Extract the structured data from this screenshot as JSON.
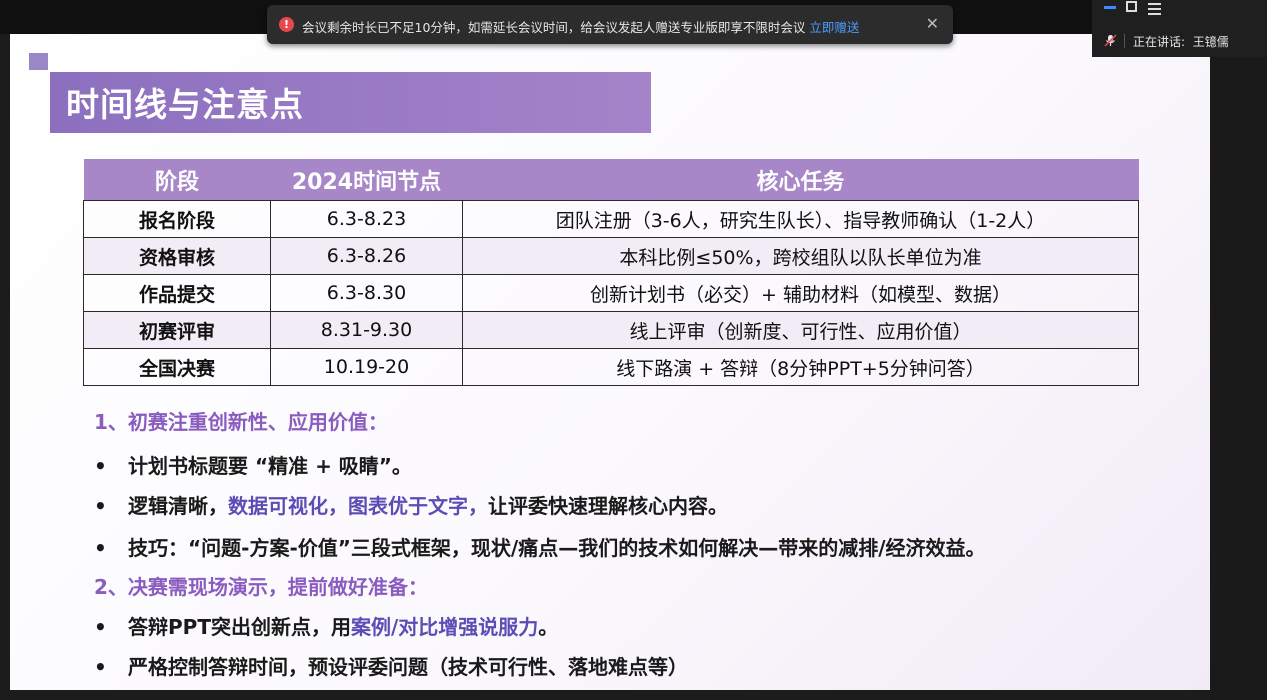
{
  "meeting": {
    "toast_message": "会议剩余时长已不足10分钟，如需延长会议时间，给会议发起人赠送专业版即享不限时会议",
    "toast_link": "立即赠送",
    "speaking_label": "正在讲话:",
    "speaker_name": "王镱儒"
  },
  "slide": {
    "title": "时间线与注意点",
    "table": {
      "headers": [
        "阶段",
        "2024时间节点",
        "核心任务"
      ],
      "rows": [
        [
          "报名阶段",
          "6.3-8.23",
          "团队注册（3-6人，研究生队长）、指导教师确认（1-2人）"
        ],
        [
          "资格审核",
          "6.3-8.26",
          "本科比例≤50%，跨校组队以队长单位为准"
        ],
        [
          "作品提交",
          "6.3-8.30",
          "创新计划书（必交）+ 辅助材料（如模型、数据）"
        ],
        [
          "初赛评审",
          "8.31-9.30",
          "线上评审（创新度、可行性、应用价值）"
        ],
        [
          "全国决赛",
          "10.19-20",
          "线下路演 + 答辩（8分钟PPT+5分钟问答）"
        ]
      ]
    },
    "notes": {
      "heading1": "1、初赛注重创新性、应用价值：",
      "bullet": "•",
      "b1": "计划书标题要 “精准 + 吸睛”。",
      "b2_a": "逻辑清晰，",
      "b2_b": "数据可视化，图表优于文字，",
      "b2_c": "让评委快速理解核心内容。",
      "b3": "技巧：“问题-方案-价值”三段式框架，现状/痛点—我们的技术如何解决—带来的减排/经济效益。",
      "heading2": "2、决赛需现场演示，提前做好准备：",
      "b4_a": "答辩PPT突出创新点，用",
      "b4_b": "案例/对比增强说服力",
      "b4_c": "。",
      "b5": "严格控制答辩时间，预设评委问题（技术可行性、落地难点等）"
    }
  },
  "colors": {
    "title_bg": "#9b7bc6",
    "highlight": "#5b4db5",
    "heading": "#8a5cc0",
    "link": "#4a9dff"
  }
}
